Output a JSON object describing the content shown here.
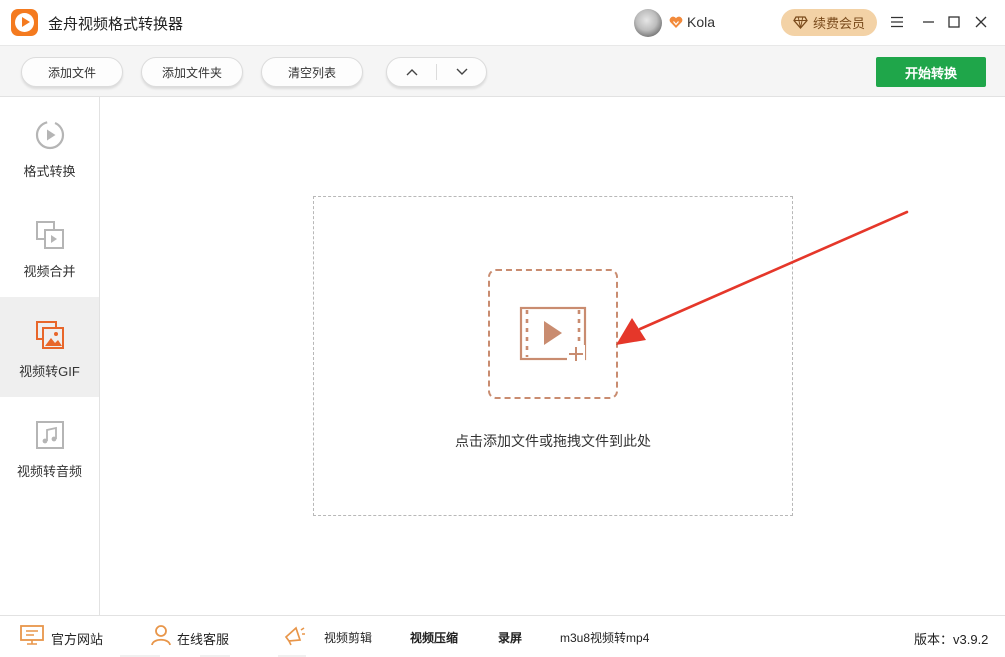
{
  "app": {
    "title": "金舟视频格式转换器"
  },
  "user": {
    "name": "Kola",
    "renew_label": "续费会员"
  },
  "toolbar": {
    "add_file": "添加文件",
    "add_folder": "添加文件夹",
    "clear_list": "清空列表",
    "start_convert": "开始转换"
  },
  "sidebar": {
    "items": [
      {
        "label": "格式转换",
        "icon": "format-convert-icon"
      },
      {
        "label": "视频合并",
        "icon": "video-merge-icon"
      },
      {
        "label": "视频转GIF",
        "icon": "gif-icon",
        "active": true
      },
      {
        "label": "视频转音频",
        "icon": "music-icon"
      }
    ]
  },
  "main": {
    "drop_hint": "点击添加文件或拖拽文件到此处"
  },
  "footer": {
    "website": "官方网站",
    "support": "在线客服",
    "video_edit": "视频剪辑",
    "video_compress": "视频压缩",
    "screen_record": "录屏",
    "m3u8": "m3u8视频转mp4",
    "version": "版本：v3.9.2"
  },
  "colors": {
    "accent_orange": "#f47a1f",
    "start_green": "#1fa64a",
    "vip_gold": "#f3d2a6",
    "active_icon": "#e8662a"
  }
}
